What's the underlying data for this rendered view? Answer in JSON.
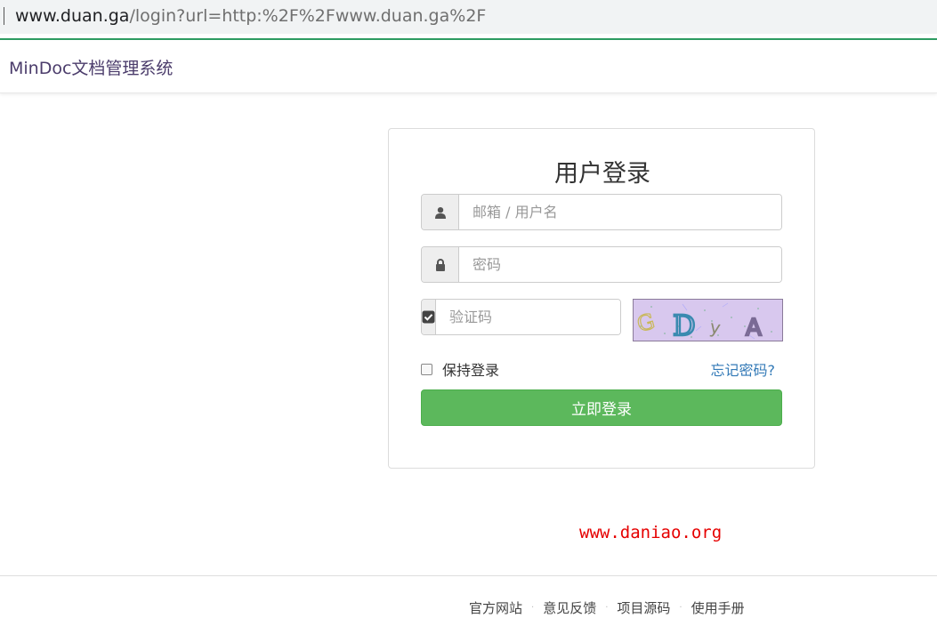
{
  "browser": {
    "url_host": "www.duan.ga",
    "url_rest": "/login?url=http:%2F%2Fwww.duan.ga%2F"
  },
  "navbar": {
    "brand": "MinDoc文档管理系统"
  },
  "login": {
    "title": "用户登录",
    "username_placeholder": "邮箱 / 用户名",
    "password_placeholder": "密码",
    "captcha_placeholder": "验证码",
    "captcha_text": "Dya",
    "remember_label": "保持登录",
    "forgot_label": "忘记密码?",
    "submit_label": "立即登录"
  },
  "watermark": "www.daniao.org",
  "footer": {
    "links": [
      "官方网站",
      "意见反馈",
      "项目源码",
      "使用手册"
    ]
  },
  "colors": {
    "accent_green": "#5cb85c",
    "link_blue": "#337ab7",
    "navbar_border": "#2d9b61",
    "watermark_red": "#e60000"
  }
}
